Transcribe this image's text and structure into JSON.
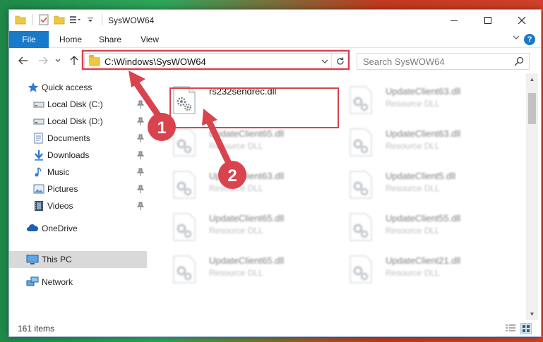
{
  "window": {
    "title": "SysWOW64"
  },
  "ribbon": {
    "tabs": [
      "File",
      "Home",
      "Share",
      "View"
    ],
    "help": "?"
  },
  "navigation": {
    "address": "C:\\Windows\\SysWOW64",
    "search_placeholder": "Search SysWOW64"
  },
  "sidebar": {
    "items": [
      {
        "label": "Quick access",
        "icon": "star-icon"
      },
      {
        "label": "Local Disk (C:)",
        "icon": "drive-icon",
        "pinned": true
      },
      {
        "label": "Local Disk (D:)",
        "icon": "drive-icon",
        "pinned": true
      },
      {
        "label": "Documents",
        "icon": "documents-icon",
        "pinned": true
      },
      {
        "label": "Downloads",
        "icon": "download-icon",
        "pinned": true
      },
      {
        "label": "Music",
        "icon": "music-icon",
        "pinned": true
      },
      {
        "label": "Pictures",
        "icon": "pictures-icon",
        "pinned": true
      },
      {
        "label": "Videos",
        "icon": "videos-icon",
        "pinned": true
      },
      {
        "label": "OneDrive",
        "icon": "cloud-icon"
      },
      {
        "label": "This PC",
        "icon": "computer-icon",
        "selected": true
      },
      {
        "label": "Network",
        "icon": "network-icon"
      }
    ]
  },
  "files": [
    {
      "name": "rs232sendrec.dll",
      "type": "",
      "highlighted": true
    },
    {
      "name": "UpdateClient63.dll",
      "type": "Resource DLL"
    },
    {
      "name": "UpdateClient65.dll",
      "type": "Resource DLL"
    },
    {
      "name": "UpdateClient63.dll",
      "type": "Resource DLL"
    },
    {
      "name": "UpdateClient63.dll",
      "type": "Resource DLL"
    },
    {
      "name": "UpdateClient5.dll",
      "type": "Resource DLL"
    },
    {
      "name": "UpdateClient65.dll",
      "type": "Resource DLL"
    },
    {
      "name": "UpdateClient55.dll",
      "type": "Resource DLL"
    },
    {
      "name": "UpdateClient65.dll",
      "type": "Resource DLL"
    },
    {
      "name": "UpdateClient21.dll",
      "type": "Resource DLL"
    }
  ],
  "status": {
    "item_count": "161 items"
  },
  "annotations": [
    {
      "label": "1"
    },
    {
      "label": "2"
    }
  ],
  "colors": {
    "accent": "#1979ca",
    "annotation": "#d9434e",
    "selected": "#d9d9d9"
  }
}
